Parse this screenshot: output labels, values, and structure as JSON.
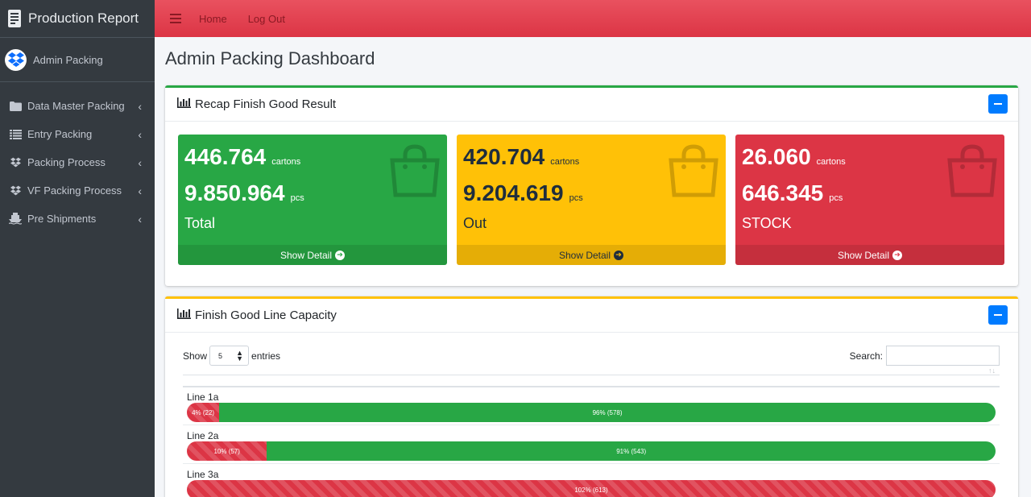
{
  "brand": {
    "title": "Production Report"
  },
  "user": {
    "name": "Admin Packing"
  },
  "sidebar": {
    "items": [
      {
        "label": "Data Master Packing",
        "icon": "folder-icon"
      },
      {
        "label": "Entry Packing",
        "icon": "list-icon"
      },
      {
        "label": "Packing Process",
        "icon": "dropbox-icon"
      },
      {
        "label": "VF Packing Process",
        "icon": "dropbox-icon"
      },
      {
        "label": "Pre Shipments",
        "icon": "ship-icon"
      }
    ]
  },
  "topbar": {
    "home": "Home",
    "logout": "Log Out"
  },
  "page": {
    "title": "Admin Packing Dashboard"
  },
  "recap": {
    "title": "Recap Finish Good Result",
    "boxes": [
      {
        "cartons": "446.764",
        "cartons_unit": "cartons",
        "pcs": "9.850.964",
        "pcs_unit": "pcs",
        "label": "Total",
        "footer": "Show Detail",
        "color": "#28a745"
      },
      {
        "cartons": "420.704",
        "cartons_unit": "cartons",
        "pcs": "9.204.619",
        "pcs_unit": "pcs",
        "label": "Out",
        "footer": "Show Detail",
        "color": "#ffc107"
      },
      {
        "cartons": "26.060",
        "cartons_unit": "cartons",
        "pcs": "646.345",
        "pcs_unit": "pcs",
        "label": "STOCK",
        "footer": "Show Detail",
        "color": "#dc3545"
      }
    ]
  },
  "capacity": {
    "title": "Finish Good Line Capacity",
    "show_label": "Show",
    "entries_value": "5",
    "entries_label": "entries",
    "search_label": "Search:",
    "lines": [
      {
        "name": "Line 1a",
        "segments": [
          {
            "pct": 4,
            "text": "4% (22)",
            "kind": "red"
          },
          {
            "pct": 96,
            "text": "96% (578)",
            "kind": "green"
          }
        ]
      },
      {
        "name": "Line 2a",
        "segments": [
          {
            "pct": 10,
            "text": "10% (57)",
            "kind": "red"
          },
          {
            "pct": 91,
            "text": "91% (543)",
            "kind": "green"
          }
        ]
      },
      {
        "name": "Line 3a",
        "segments": [
          {
            "pct": 102,
            "text": "102% (613)",
            "kind": "red"
          }
        ]
      }
    ]
  }
}
